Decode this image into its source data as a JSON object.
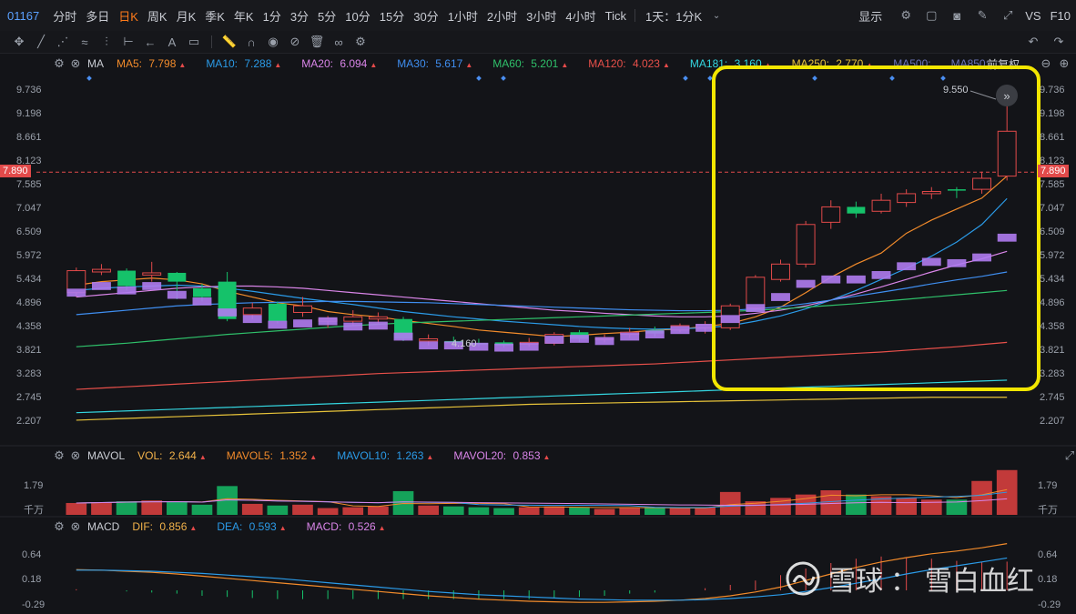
{
  "topbar": {
    "code": "01167",
    "periods": [
      "分时",
      "多日",
      "日K",
      "周K",
      "月K",
      "季K",
      "年K",
      "1分",
      "3分",
      "5分",
      "10分",
      "15分",
      "30分",
      "1小时",
      "2小时",
      "3小时",
      "4小时",
      "Tick"
    ],
    "active_period": "日K",
    "custom_period": "1天：1分K",
    "display_label": "显示",
    "vs_label": "VS",
    "f10_label": "F10"
  },
  "main_chart": {
    "ma_label": "MA",
    "ma_items": [
      {
        "name": "MA5",
        "value": "7.798",
        "color": "#f28b2b"
      },
      {
        "name": "MA10",
        "value": "7.288",
        "color": "#2b9be8"
      },
      {
        "name": "MA20",
        "value": "6.094",
        "color": "#d985e8"
      },
      {
        "name": "MA30",
        "value": "5.617",
        "color": "#3f8ef0"
      },
      {
        "name": "MA60",
        "value": "5.201",
        "color": "#2fc06a"
      },
      {
        "name": "MA120",
        "value": "4.023",
        "color": "#e8504a"
      },
      {
        "name": "MA181",
        "value": "3.160",
        "color": "#34d6e0"
      },
      {
        "name": "MA250",
        "value": "2.770",
        "color": "#e8c43a"
      },
      {
        "name": "MA500",
        "value": "",
        "color": "#6b73b8"
      },
      {
        "name": "MA850",
        "value": "",
        "color": "#6b73b8"
      }
    ],
    "adjust_label": "前复权",
    "y_ticks": [
      "9.736",
      "9.198",
      "8.661",
      "8.123",
      "7.585",
      "7.047",
      "6.509",
      "5.972",
      "5.434",
      "4.896",
      "4.358",
      "3.821",
      "3.283",
      "2.745",
      "2.207"
    ],
    "current_price": "7.890",
    "high_label": "9.550",
    "low_label": "4.160"
  },
  "chart_data": {
    "type": "candlestick",
    "ylim": [
      2.207,
      9.736
    ],
    "candles": [
      {
        "o": 5.15,
        "c": 5.65,
        "h": 5.72,
        "l": 5.05,
        "dir": "up"
      },
      {
        "o": 5.62,
        "c": 5.68,
        "h": 5.8,
        "l": 5.55,
        "dir": "up"
      },
      {
        "o": 5.65,
        "c": 5.3,
        "h": 5.7,
        "l": 5.2,
        "dir": "down"
      },
      {
        "o": 5.55,
        "c": 5.6,
        "h": 5.85,
        "l": 5.4,
        "dir": "up"
      },
      {
        "o": 5.6,
        "c": 5.4,
        "h": 5.62,
        "l": 5.0,
        "dir": "down"
      },
      {
        "o": 5.25,
        "c": 5.05,
        "h": 5.35,
        "l": 4.95,
        "dir": "down"
      },
      {
        "o": 5.4,
        "c": 4.55,
        "h": 5.62,
        "l": 4.5,
        "dir": "down"
      },
      {
        "o": 4.65,
        "c": 4.8,
        "h": 4.92,
        "l": 4.55,
        "dir": "up"
      },
      {
        "o": 4.9,
        "c": 4.5,
        "h": 4.95,
        "l": 4.45,
        "dir": "down"
      },
      {
        "o": 4.7,
        "c": 4.85,
        "h": 5.05,
        "l": 4.6,
        "dir": "up"
      },
      {
        "o": 4.5,
        "c": 4.55,
        "h": 4.62,
        "l": 4.35,
        "dir": "up"
      },
      {
        "o": 4.5,
        "c": 4.6,
        "h": 4.75,
        "l": 4.4,
        "dir": "up"
      },
      {
        "o": 4.55,
        "c": 4.6,
        "h": 4.7,
        "l": 4.45,
        "dir": "up"
      },
      {
        "o": 4.55,
        "c": 4.1,
        "h": 4.6,
        "l": 4.05,
        "dir": "down"
      },
      {
        "o": 4.05,
        "c": 4.1,
        "h": 4.2,
        "l": 3.95,
        "dir": "up"
      },
      {
        "o": 4.05,
        "c": 4.0,
        "h": 4.15,
        "l": 3.92,
        "dir": "down"
      },
      {
        "o": 4.0,
        "c": 3.98,
        "h": 4.1,
        "l": 3.92,
        "dir": "down"
      },
      {
        "o": 4.02,
        "c": 3.95,
        "h": 4.06,
        "l": 3.9,
        "dir": "down"
      },
      {
        "o": 3.98,
        "c": 4.02,
        "h": 4.12,
        "l": 3.92,
        "dir": "up"
      },
      {
        "o": 4.0,
        "c": 4.2,
        "h": 4.25,
        "l": 3.95,
        "dir": "up"
      },
      {
        "o": 4.25,
        "c": 4.1,
        "h": 4.3,
        "l": 4.02,
        "dir": "down"
      },
      {
        "o": 4.08,
        "c": 4.12,
        "h": 4.2,
        "l": 4.02,
        "dir": "up"
      },
      {
        "o": 4.2,
        "c": 4.25,
        "h": 4.35,
        "l": 4.12,
        "dir": "up"
      },
      {
        "o": 4.3,
        "c": 4.22,
        "h": 4.38,
        "l": 4.15,
        "dir": "down"
      },
      {
        "o": 4.3,
        "c": 4.4,
        "h": 4.45,
        "l": 4.25,
        "dir": "up"
      },
      {
        "o": 4.35,
        "c": 4.42,
        "h": 4.5,
        "l": 4.22,
        "dir": "up"
      },
      {
        "o": 4.35,
        "c": 4.85,
        "h": 4.9,
        "l": 4.3,
        "dir": "up"
      },
      {
        "o": 4.8,
        "c": 5.5,
        "h": 5.55,
        "l": 4.75,
        "dir": "up"
      },
      {
        "o": 5.45,
        "c": 5.8,
        "h": 5.9,
        "l": 5.4,
        "dir": "up"
      },
      {
        "o": 5.8,
        "c": 6.7,
        "h": 6.78,
        "l": 5.72,
        "dir": "up"
      },
      {
        "o": 6.75,
        "c": 7.1,
        "h": 7.25,
        "l": 6.6,
        "dir": "up"
      },
      {
        "o": 7.1,
        "c": 6.95,
        "h": 7.22,
        "l": 6.85,
        "dir": "down"
      },
      {
        "o": 7.0,
        "c": 7.25,
        "h": 7.4,
        "l": 6.95,
        "dir": "up"
      },
      {
        "o": 7.2,
        "c": 7.4,
        "h": 7.5,
        "l": 7.1,
        "dir": "up"
      },
      {
        "o": 7.4,
        "c": 7.45,
        "h": 7.55,
        "l": 7.28,
        "dir": "up"
      },
      {
        "o": 7.48,
        "c": 7.5,
        "h": 7.55,
        "l": 7.3,
        "dir": "down"
      },
      {
        "o": 7.5,
        "c": 7.75,
        "h": 7.9,
        "l": 7.4,
        "dir": "up"
      },
      {
        "o": 7.8,
        "c": 8.82,
        "h": 9.55,
        "l": 7.7,
        "dir": "up"
      }
    ],
    "ma_lines": [
      {
        "name": "MA5",
        "color": "#f28b2b",
        "values": [
          5.32,
          5.4,
          5.44,
          5.48,
          5.44,
          5.35,
          5.18,
          5.05,
          4.92,
          4.85,
          4.72,
          4.65,
          4.6,
          4.52,
          4.45,
          4.38,
          4.3,
          4.25,
          4.2,
          4.15,
          4.18,
          4.22,
          4.25,
          4.3,
          4.32,
          4.38,
          4.45,
          4.6,
          4.82,
          5.15,
          5.5,
          5.8,
          6.05,
          6.5,
          6.8,
          7.05,
          7.3,
          7.8
        ]
      },
      {
        "name": "MA10",
        "color": "#2b9be8",
        "values": [
          5.2,
          5.25,
          5.28,
          5.3,
          5.32,
          5.3,
          5.25,
          5.18,
          5.1,
          5.02,
          4.95,
          4.88,
          4.8,
          4.72,
          4.66,
          4.6,
          4.55,
          4.5,
          4.46,
          4.42,
          4.38,
          4.35,
          4.33,
          4.32,
          4.33,
          4.35,
          4.4,
          4.5,
          4.62,
          4.78,
          4.98,
          5.2,
          5.45,
          5.7,
          5.98,
          6.3,
          6.7,
          7.29
        ]
      },
      {
        "name": "MA20",
        "color": "#d985e8",
        "values": [
          5.05,
          5.1,
          5.15,
          5.2,
          5.25,
          5.28,
          5.3,
          5.3,
          5.28,
          5.25,
          5.2,
          5.15,
          5.1,
          5.05,
          5.0,
          4.95,
          4.9,
          4.85,
          4.8,
          4.75,
          4.72,
          4.68,
          4.65,
          4.62,
          4.6,
          4.6,
          4.62,
          4.68,
          4.75,
          4.85,
          4.98,
          5.12,
          5.28,
          5.45,
          5.62,
          5.78,
          5.92,
          6.09
        ]
      },
      {
        "name": "MA30",
        "color": "#3f8ef0",
        "values": [
          4.65,
          4.7,
          4.75,
          4.8,
          4.85,
          4.88,
          4.9,
          4.92,
          4.93,
          4.94,
          4.95,
          4.95,
          4.94,
          4.93,
          4.92,
          4.9,
          4.88,
          4.86,
          4.84,
          4.82,
          4.8,
          4.78,
          4.76,
          4.75,
          4.74,
          4.74,
          4.75,
          4.78,
          4.83,
          4.9,
          4.98,
          5.07,
          5.16,
          5.25,
          5.35,
          5.44,
          5.52,
          5.62
        ]
      },
      {
        "name": "MA60",
        "color": "#2fc06a",
        "values": [
          3.92,
          3.96,
          4.0,
          4.05,
          4.1,
          4.15,
          4.2,
          4.24,
          4.28,
          4.32,
          4.36,
          4.4,
          4.43,
          4.46,
          4.48,
          4.5,
          4.52,
          4.54,
          4.56,
          4.58,
          4.6,
          4.62,
          4.64,
          4.66,
          4.68,
          4.7,
          4.72,
          4.75,
          4.78,
          4.82,
          4.86,
          4.9,
          4.95,
          5.0,
          5.05,
          5.1,
          5.15,
          5.2
        ]
      },
      {
        "name": "MA120",
        "color": "#e8504a",
        "values": [
          2.95,
          2.98,
          3.01,
          3.04,
          3.07,
          3.1,
          3.13,
          3.16,
          3.19,
          3.22,
          3.25,
          3.28,
          3.31,
          3.33,
          3.35,
          3.37,
          3.39,
          3.41,
          3.43,
          3.45,
          3.47,
          3.49,
          3.51,
          3.53,
          3.56,
          3.59,
          3.62,
          3.65,
          3.68,
          3.71,
          3.74,
          3.77,
          3.8,
          3.84,
          3.88,
          3.92,
          3.97,
          4.02
        ]
      },
      {
        "name": "MA181",
        "color": "#34d6e0",
        "values": [
          2.42,
          2.44,
          2.46,
          2.48,
          2.5,
          2.52,
          2.54,
          2.56,
          2.58,
          2.6,
          2.62,
          2.64,
          2.66,
          2.68,
          2.7,
          2.72,
          2.74,
          2.76,
          2.78,
          2.8,
          2.82,
          2.84,
          2.86,
          2.88,
          2.9,
          2.92,
          2.94,
          2.96,
          2.98,
          3.0,
          3.02,
          3.04,
          3.06,
          3.08,
          3.1,
          3.12,
          3.14,
          3.16
        ]
      },
      {
        "name": "MA250",
        "color": "#e8c43a",
        "values": [
          2.25,
          2.27,
          2.29,
          2.31,
          2.33,
          2.35,
          2.37,
          2.39,
          2.41,
          2.43,
          2.45,
          2.47,
          2.49,
          2.51,
          2.53,
          2.55,
          2.57,
          2.59,
          2.61,
          2.62,
          2.63,
          2.64,
          2.65,
          2.66,
          2.67,
          2.68,
          2.69,
          2.7,
          2.71,
          2.72,
          2.73,
          2.74,
          2.75,
          2.76,
          2.77,
          2.77,
          2.77,
          2.77
        ]
      }
    ],
    "volumes": [
      0.7,
      0.75,
      0.8,
      0.85,
      0.8,
      0.6,
      1.7,
      0.65,
      0.55,
      0.6,
      0.4,
      0.45,
      0.5,
      1.4,
      0.55,
      0.5,
      0.45,
      0.4,
      0.45,
      0.5,
      0.45,
      0.35,
      0.4,
      0.42,
      0.4,
      0.45,
      1.35,
      0.8,
      1.0,
      1.2,
      1.45,
      1.2,
      1.1,
      1.0,
      0.9,
      0.9,
      2.0,
      2.644
    ],
    "vol_ylim": [
      0,
      2.9
    ],
    "macd": {
      "dif": [
        0.38,
        0.37,
        0.35,
        0.33,
        0.3,
        0.26,
        0.22,
        0.18,
        0.14,
        0.1,
        0.06,
        0.02,
        -0.02,
        -0.06,
        -0.1,
        -0.13,
        -0.16,
        -0.18,
        -0.2,
        -0.21,
        -0.22,
        -0.22,
        -0.21,
        -0.2,
        -0.18,
        -0.15,
        -0.1,
        -0.03,
        0.06,
        0.18,
        0.3,
        0.42,
        0.52,
        0.6,
        0.67,
        0.72,
        0.78,
        0.856
      ],
      "dea": [
        0.37,
        0.37,
        0.36,
        0.35,
        0.33,
        0.31,
        0.28,
        0.25,
        0.22,
        0.18,
        0.14,
        0.1,
        0.06,
        0.02,
        -0.02,
        -0.05,
        -0.08,
        -0.1,
        -0.12,
        -0.14,
        -0.16,
        -0.17,
        -0.18,
        -0.18,
        -0.18,
        -0.17,
        -0.15,
        -0.12,
        -0.08,
        -0.02,
        0.05,
        0.13,
        0.21,
        0.3,
        0.38,
        0.45,
        0.52,
        0.593
      ],
      "ylim": [
        -0.35,
        0.95
      ]
    }
  },
  "vol_panel": {
    "label": "MAVOL",
    "items": [
      {
        "name": "VOL",
        "value": "2.644",
        "color": "#f2b24a"
      },
      {
        "name": "MAVOL5",
        "value": "1.352",
        "color": "#f28b2b"
      },
      {
        "name": "MAVOL10",
        "value": "1.263",
        "color": "#2b9be8"
      },
      {
        "name": "MAVOL20",
        "value": "0.853",
        "color": "#d985e8"
      }
    ],
    "y_tick": "1.79",
    "unit": "千万"
  },
  "macd_panel": {
    "label": "MACD",
    "items": [
      {
        "name": "DIF",
        "value": "0.856",
        "color": "#f2b24a"
      },
      {
        "name": "DEA",
        "value": "0.593",
        "color": "#2b9be8"
      },
      {
        "name": "MACD",
        "value": "0.526",
        "color": "#d985e8"
      }
    ],
    "y_ticks": [
      "0.64",
      "0.18",
      "-0.29"
    ]
  },
  "watermark": {
    "brand": "雪球",
    "separator": "：",
    "author": "雪白血红"
  }
}
